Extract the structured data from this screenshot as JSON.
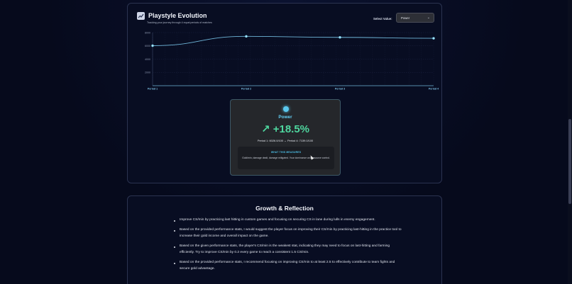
{
  "playstyle": {
    "title": "Playstyle Evolution",
    "subtitle": "Tracking your journey through 4 equal periods of matches",
    "select_label": "Select Value:",
    "select_value": "Power",
    "chart_data": {
      "type": "line",
      "x": [
        "Period 1",
        "Period 2",
        "Period 3",
        "Period 4"
      ],
      "series": [
        {
          "values": [
            6026.0,
            7430.0,
            7280.0,
            7139.0
          ]
        }
      ],
      "y_ticks": [
        "8000",
        "6000",
        "4000",
        "2000"
      ],
      "ylim": [
        0,
        8000
      ],
      "grid": true,
      "line_color": "#6fb6d9"
    }
  },
  "stat": {
    "name": "Power",
    "change": "↗ +18.5%",
    "range": "Period 1: 6026.0/100 → Period 4: 7139.0/100",
    "measure_title": "WHAT THIS MEASURES",
    "measure_text": "Gold/min, damage dealt, damage mitigated. Your dominance and resource control.",
    "accent": "#63d0f5",
    "positive_color": "#4ed69e"
  },
  "growth": {
    "title": "Growth & Reflection",
    "items": [
      "Improve CS/min by practicing last hitting in custom games and focusing on securing CS in lane during lulls in enemy engagement.",
      "Based on the provided performance stats, I would suggest the player focus on improving their CS/min by practicing last-hitting in the practice tool to increase their gold income and overall impact on the game.",
      "Based on the given performance stats, the player's CS/min is the weakest stat, indicating they may need to focus on last-hitting and farming efficiently. Try to improve CS/min by 0.2 every game to reach a consistent 1.5 CS/min.",
      "Based on the provided performance stats, I recommend focusing on improving CS/min to at least 2.5 to effectively contribute to team fights and secure gold advantage."
    ]
  }
}
